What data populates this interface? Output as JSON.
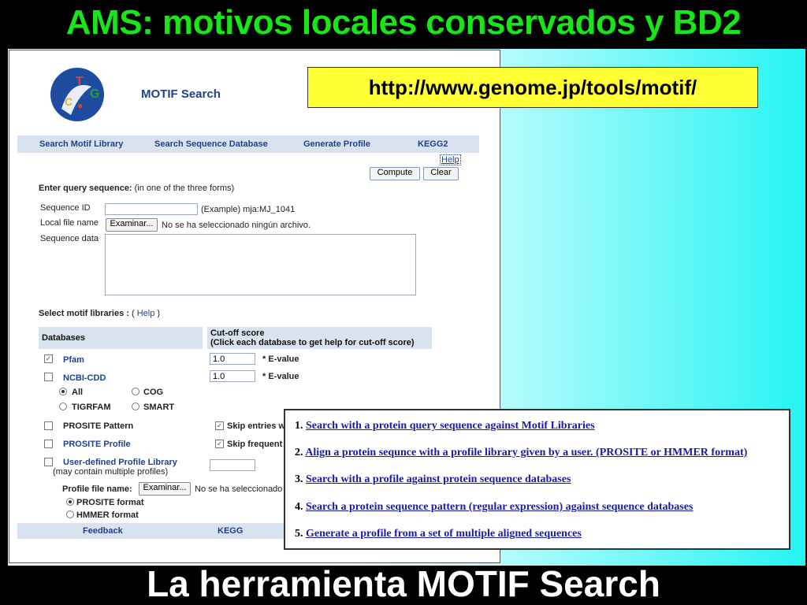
{
  "slide": {
    "title": "AMS: motivos locales conservados y BD2",
    "footer": "La herramienta MOTIF Search"
  },
  "page": {
    "brand": "MOTIF Search",
    "url": "http://www.genome.jp/tools/motif/",
    "nav": [
      "Search Motif Library",
      "Search Sequence Database",
      "Generate Profile",
      "KEGG2"
    ],
    "help_top": "Help",
    "compute_label": "Compute",
    "clear_label": "Clear",
    "query_heading": "Enter query sequence:",
    "query_hint": " (in one of the three forms)",
    "seq_id_label": "Sequence ID",
    "seq_id_example": "(Example) mja:MJ_1041",
    "local_file_label": "Local file name",
    "browse_label": "Examinar...",
    "no_file": "No se ha seleccionado ningún archivo.",
    "seq_data_label": "Sequence data",
    "motif_lib_heading": "Select motif libraries :",
    "motif_lib_help_open": "( ",
    "motif_lib_help": "Help",
    "motif_lib_help_close": " )",
    "db_header": "Databases",
    "cutoff_header_1": "Cut-off score",
    "cutoff_header_2": "(Click each database to get help for cut-off score)",
    "pfam_label": "Pfam",
    "pfam_value": "1.0",
    "ncbi_label": "NCBI-CDD",
    "ncbi_value": "1.0",
    "evalue_label": "* E-value",
    "cdd_options": [
      "All",
      "COG",
      "TIGRFAM",
      "SMART"
    ],
    "prosite_pattern": "PROSITE Pattern",
    "prosite_profile": "PROSITE Profile",
    "skip_entries": "Skip entries w",
    "skip_frequent": "Skip frequent",
    "user_defined": "User-defined Profile Library",
    "user_defined_note": "(may contain multiple profiles)",
    "profile_file_label": "Profile file name:",
    "no_file_short": "No se ha seleccionado",
    "formats": [
      "PROSITE format",
      "HMMER format"
    ],
    "footer_links": [
      "Feedback",
      "KEGG"
    ]
  },
  "overlay": {
    "items": [
      {
        "num": "1.",
        "text": "Search with a protein query sequence against Motif Libraries"
      },
      {
        "num": "2.",
        "text": "Align a protein sequnce with a profile library given by a user. (PROSITE or HMMER format)"
      },
      {
        "num": "3.",
        "text": "Search with a profile against protein sequence databases"
      },
      {
        "num": "4.",
        "text": "Search a protein sequence pattern (regular expression) against sequence databases"
      },
      {
        "num": "5.",
        "text": "Generate a profile from a set of multiple aligned sequences"
      }
    ]
  },
  "colors": {
    "title_green": "#19e619",
    "url_yellow": "#ffff33",
    "link_blue": "#1a1aa8",
    "nav_blue": "#1f3f8f"
  }
}
